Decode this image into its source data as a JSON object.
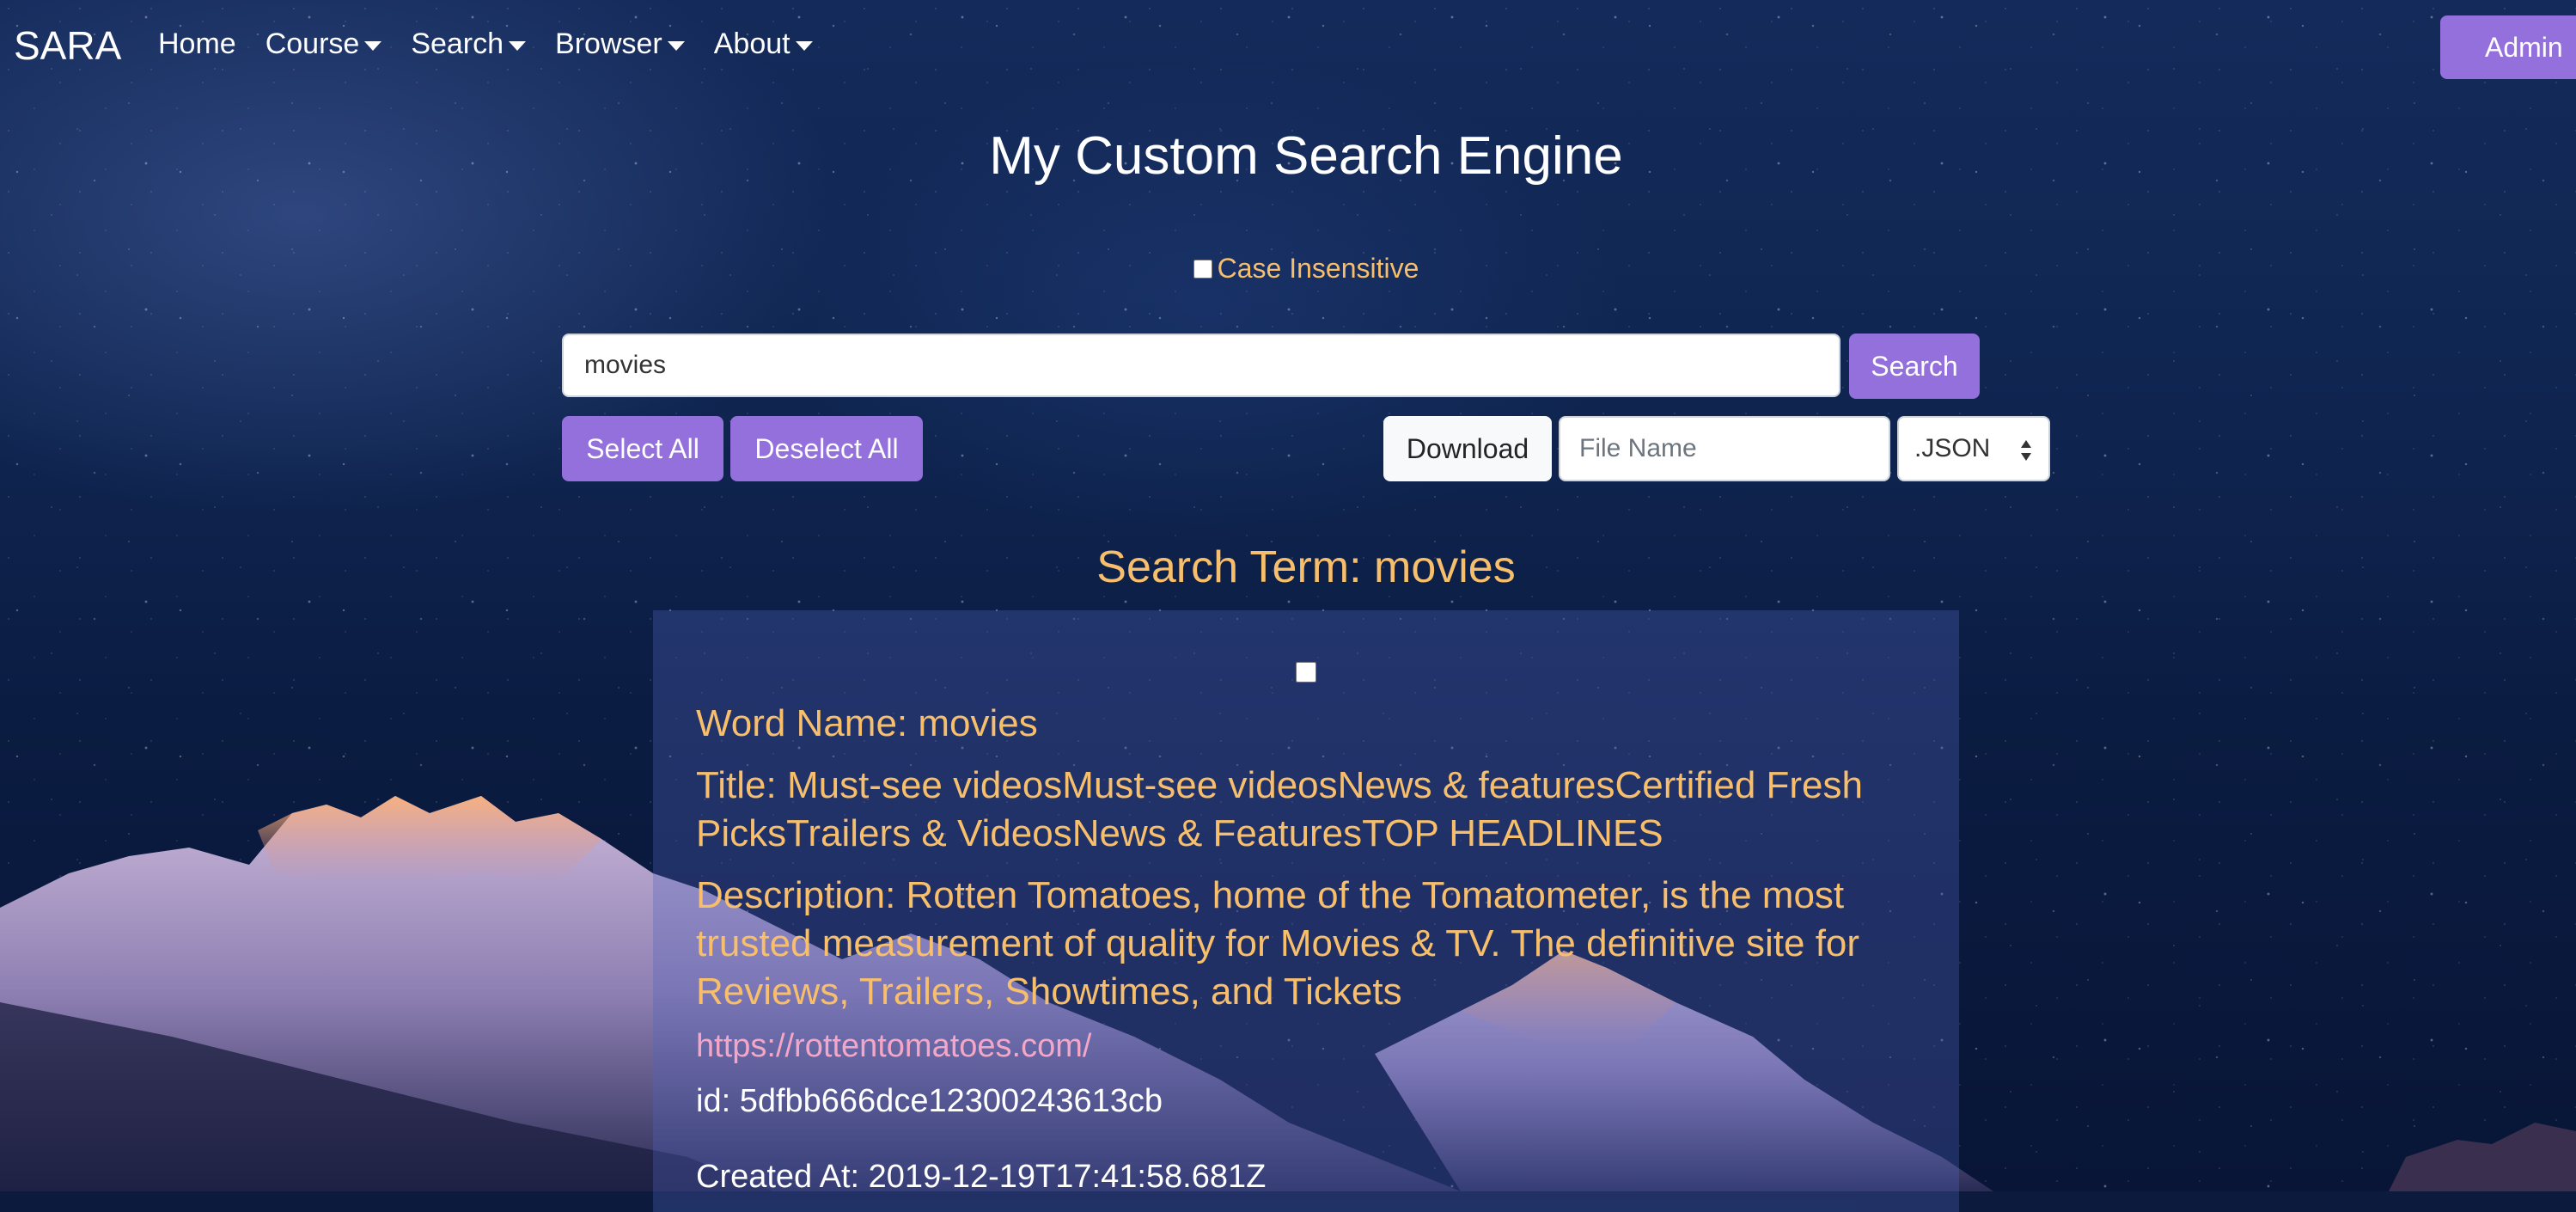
{
  "navbar": {
    "brand": "SARA",
    "links": [
      {
        "label": "Home",
        "dropdown": false
      },
      {
        "label": "Course",
        "dropdown": true
      },
      {
        "label": "Search",
        "dropdown": true
      },
      {
        "label": "Browser",
        "dropdown": true
      },
      {
        "label": "About",
        "dropdown": true
      }
    ],
    "admin_label": "Admin"
  },
  "page": {
    "title": "My Custom Search Engine",
    "case_insensitive_label": "Case Insensitive",
    "case_insensitive_checked": false
  },
  "search": {
    "value": "movies",
    "button_label": "Search"
  },
  "actions": {
    "select_all_label": "Select All",
    "deselect_all_label": "Deselect All",
    "download_label": "Download",
    "file_name_placeholder": "File Name",
    "format_selected": ".JSON"
  },
  "results": {
    "heading": "Search Term: movies",
    "items": [
      {
        "checked": false,
        "word_name": "Word Name: movies",
        "title": "Title: Must-see videosMust-see videosNews & featuresCertified Fresh PicksTrailers & VideosNews & FeaturesTOP HEADLINES",
        "description": "Description: Rotten Tomatoes, home of the Tomatometer, is the most trusted measurement of quality for Movies & TV. The definitive site for Reviews, Trailers, Showtimes, and Tickets",
        "url": "https://rottentomatoes.com/",
        "id": "id: 5dfbb666dce12300243613cb",
        "created_at": "Created At: 2019-12-19T17:41:58.681Z"
      }
    ]
  },
  "colors": {
    "accent_purple": "#9370db",
    "highlight_orange": "#f7be6b",
    "link_pink": "#f4a6c6"
  }
}
